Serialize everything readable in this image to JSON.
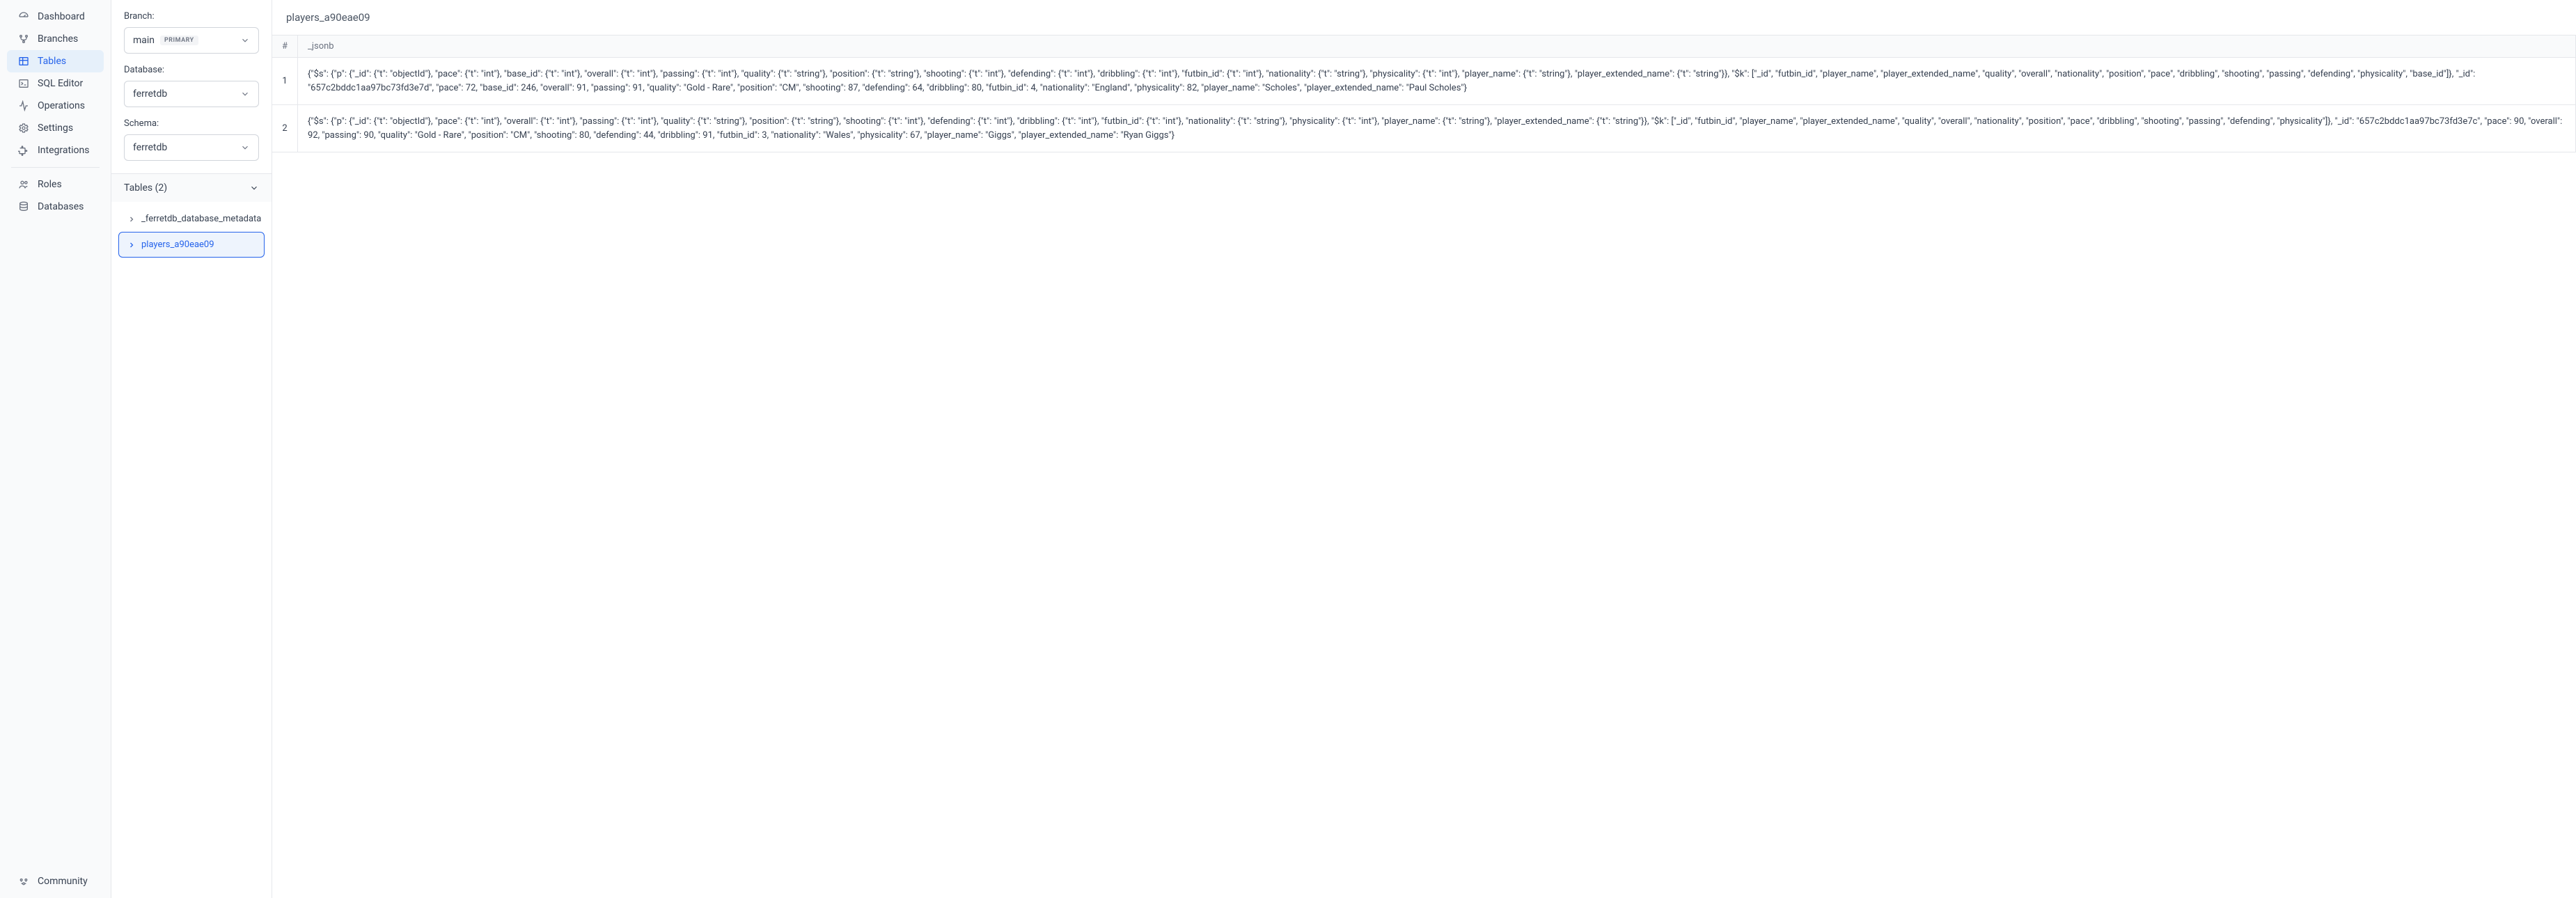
{
  "nav": {
    "items": [
      {
        "key": "dashboard",
        "label": "Dashboard"
      },
      {
        "key": "branches",
        "label": "Branches"
      },
      {
        "key": "tables",
        "label": "Tables"
      },
      {
        "key": "sql",
        "label": "SQL Editor"
      },
      {
        "key": "operations",
        "label": "Operations"
      },
      {
        "key": "settings",
        "label": "Settings"
      },
      {
        "key": "integrations",
        "label": "Integrations"
      },
      {
        "key": "roles",
        "label": "Roles"
      },
      {
        "key": "databases",
        "label": "Databases"
      },
      {
        "key": "community",
        "label": "Community"
      }
    ]
  },
  "sidepanel": {
    "branch_label": "Branch:",
    "branch_value": "main",
    "branch_badge": "PRIMARY",
    "database_label": "Database:",
    "database_value": "ferretdb",
    "schema_label": "Schema:",
    "schema_value": "ferretdb",
    "tables_header": "Tables (2)",
    "tables": [
      {
        "name": "_ferretdb_database_metadata"
      },
      {
        "name": "players_a90eae09"
      }
    ]
  },
  "content": {
    "title": "players_a90eae09",
    "columns": {
      "idx": "#",
      "jsonb": "_jsonb"
    },
    "rows": [
      {
        "idx": "1",
        "jsonb": "{\"$s\": {\"p\": {\"_id\": {\"t\": \"objectId\"}, \"pace\": {\"t\": \"int\"}, \"base_id\": {\"t\": \"int\"}, \"overall\": {\"t\": \"int\"}, \"passing\": {\"t\": \"int\"}, \"quality\": {\"t\": \"string\"}, \"position\": {\"t\": \"string\"}, \"shooting\": {\"t\": \"int\"}, \"defending\": {\"t\": \"int\"}, \"dribbling\": {\"t\": \"int\"}, \"futbin_id\": {\"t\": \"int\"}, \"nationality\": {\"t\": \"string\"}, \"physicality\": {\"t\": \"int\"}, \"player_name\": {\"t\": \"string\"}, \"player_extended_name\": {\"t\": \"string\"}}, \"$k\": [\"_id\", \"futbin_id\", \"player_name\", \"player_extended_name\", \"quality\", \"overall\", \"nationality\", \"position\", \"pace\", \"dribbling\", \"shooting\", \"passing\", \"defending\", \"physicality\", \"base_id\"]}, \"_id\": \"657c2bddc1aa97bc73fd3e7d\", \"pace\": 72, \"base_id\": 246, \"overall\": 91, \"passing\": 91, \"quality\": \"Gold - Rare\", \"position\": \"CM\", \"shooting\": 87, \"defending\": 64, \"dribbling\": 80, \"futbin_id\": 4, \"nationality\": \"England\", \"physicality\": 82, \"player_name\": \"Scholes\", \"player_extended_name\": \"Paul Scholes\"}"
      },
      {
        "idx": "2",
        "jsonb": "{\"$s\": {\"p\": {\"_id\": {\"t\": \"objectId\"}, \"pace\": {\"t\": \"int\"}, \"overall\": {\"t\": \"int\"}, \"passing\": {\"t\": \"int\"}, \"quality\": {\"t\": \"string\"}, \"position\": {\"t\": \"string\"}, \"shooting\": {\"t\": \"int\"}, \"defending\": {\"t\": \"int\"}, \"dribbling\": {\"t\": \"int\"}, \"futbin_id\": {\"t\": \"int\"}, \"nationality\": {\"t\": \"string\"}, \"physicality\": {\"t\": \"int\"}, \"player_name\": {\"t\": \"string\"}, \"player_extended_name\": {\"t\": \"string\"}}, \"$k\": [\"_id\", \"futbin_id\", \"player_name\", \"player_extended_name\", \"quality\", \"overall\", \"nationality\", \"position\", \"pace\", \"dribbling\", \"shooting\", \"passing\", \"defending\", \"physicality\"]}, \"_id\": \"657c2bddc1aa97bc73fd3e7c\", \"pace\": 90, \"overall\": 92, \"passing\": 90, \"quality\": \"Gold - Rare\", \"position\": \"CM\", \"shooting\": 80, \"defending\": 44, \"dribbling\": 91, \"futbin_id\": 3, \"nationality\": \"Wales\", \"physicality\": 67, \"player_name\": \"Giggs\", \"player_extended_name\": \"Ryan Giggs\"}"
      }
    ]
  }
}
